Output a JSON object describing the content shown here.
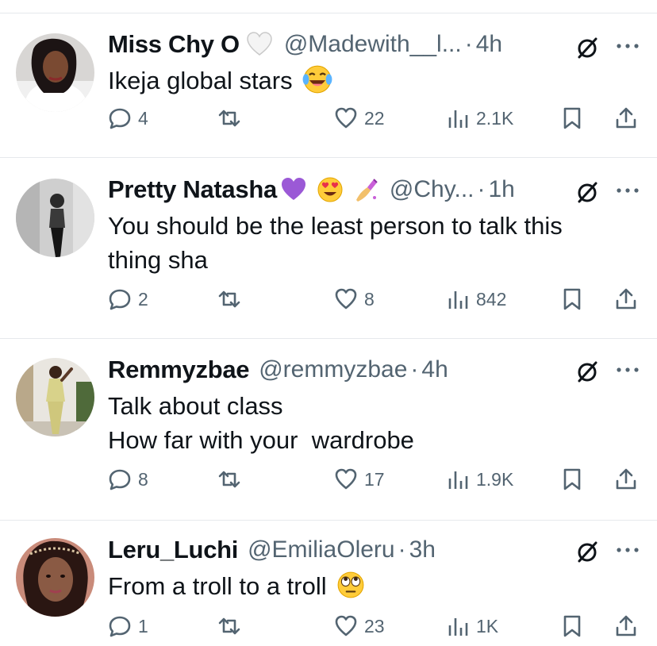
{
  "tweets": [
    {
      "name": "Miss Chy O",
      "name_emojis": [
        "white-heart"
      ],
      "handle": "@Madewith__l...",
      "time": "4h",
      "lines": [
        "Ikeja global stars"
      ],
      "text_emoji": "tears-of-joy",
      "replies": "4",
      "retweets": "",
      "likes": "22",
      "views": "2.1K"
    },
    {
      "name": "Pretty Natasha",
      "name_emojis": [
        "purple-heart",
        "heart-eyes",
        "nail-polish"
      ],
      "handle": "@Chy...",
      "time": "1h",
      "lines": [
        "You should be the least person to talk this",
        "thing sha"
      ],
      "text_emoji": "",
      "replies": "2",
      "retweets": "",
      "likes": "8",
      "views": "842"
    },
    {
      "name": "Remmyzbae",
      "name_emojis": [],
      "handle": "@remmyzbae",
      "time": "4h",
      "lines": [
        "Talk about class",
        "How far with your  wardrobe"
      ],
      "text_emoji": "",
      "replies": "8",
      "retweets": "",
      "likes": "17",
      "views": "1.9K"
    },
    {
      "name": "Leru_Luchi",
      "name_emojis": [],
      "handle": "@EmiliaOleru",
      "time": "3h",
      "lines": [
        "From a troll to a troll"
      ],
      "text_emoji": "rolling-eyes",
      "replies": "1",
      "retweets": "",
      "likes": "23",
      "views": "1K"
    }
  ],
  "colors": {
    "text": "#0f1419",
    "secondary": "#536471",
    "divider": "#e6e9ec",
    "purple_heart": "#9b59d6"
  }
}
